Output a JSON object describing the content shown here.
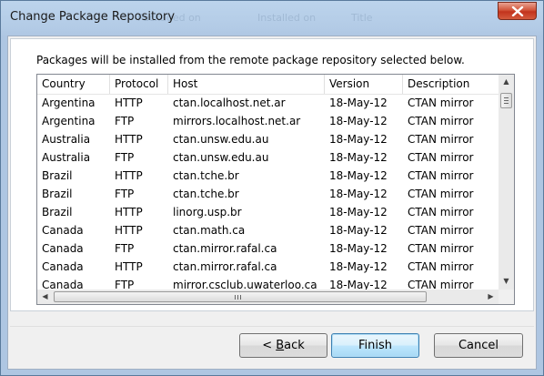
{
  "window": {
    "title": "Change Package Repository",
    "background_ghost_headers": [
      "Packaged on",
      "Installed on",
      "Title"
    ]
  },
  "dialog": {
    "instruction": "Packages will be installed from the remote package repository selected below."
  },
  "table": {
    "columns": [
      "Country",
      "Protocol",
      "Host",
      "Version",
      "Description"
    ],
    "rows": [
      [
        "Argentina",
        "HTTP",
        "ctan.localhost.net.ar",
        "18-May-12",
        "CTAN mirror"
      ],
      [
        "Argentina",
        "FTP",
        "mirrors.localhost.net.ar",
        "18-May-12",
        "CTAN mirror"
      ],
      [
        "Australia",
        "HTTP",
        "ctan.unsw.edu.au",
        "18-May-12",
        "CTAN mirror"
      ],
      [
        "Australia",
        "FTP",
        "ctan.unsw.edu.au",
        "18-May-12",
        "CTAN mirror"
      ],
      [
        "Brazil",
        "HTTP",
        "ctan.tche.br",
        "18-May-12",
        "CTAN mirror"
      ],
      [
        "Brazil",
        "FTP",
        "ctan.tche.br",
        "18-May-12",
        "CTAN mirror"
      ],
      [
        "Brazil",
        "HTTP",
        "linorg.usp.br",
        "18-May-12",
        "CTAN mirror"
      ],
      [
        "Canada",
        "HTTP",
        "ctan.math.ca",
        "18-May-12",
        "CTAN mirror"
      ],
      [
        "Canada",
        "FTP",
        "ctan.mirror.rafal.ca",
        "18-May-12",
        "CTAN mirror"
      ],
      [
        "Canada",
        "HTTP",
        "ctan.mirror.rafal.ca",
        "18-May-12",
        "CTAN mirror"
      ],
      [
        "Canada",
        "FTP",
        "mirror.csclub.uwaterloo.ca",
        "18-May-12",
        "CTAN mirror"
      ]
    ]
  },
  "buttons": {
    "back_prefix": "< ",
    "back_mnemonic": "B",
    "back_rest": "ack",
    "finish": "Finish",
    "cancel": "Cancel"
  },
  "icons": {
    "close": "close-icon",
    "scroll_up": "scroll-up-icon",
    "scroll_down": "scroll-down-icon",
    "scroll_left": "scroll-left-icon",
    "scroll_right": "scroll-right-icon"
  },
  "colors": {
    "title_bar": "#b3cbe6",
    "close_button": "#c2331d",
    "default_button_border": "#3c7fb1"
  }
}
